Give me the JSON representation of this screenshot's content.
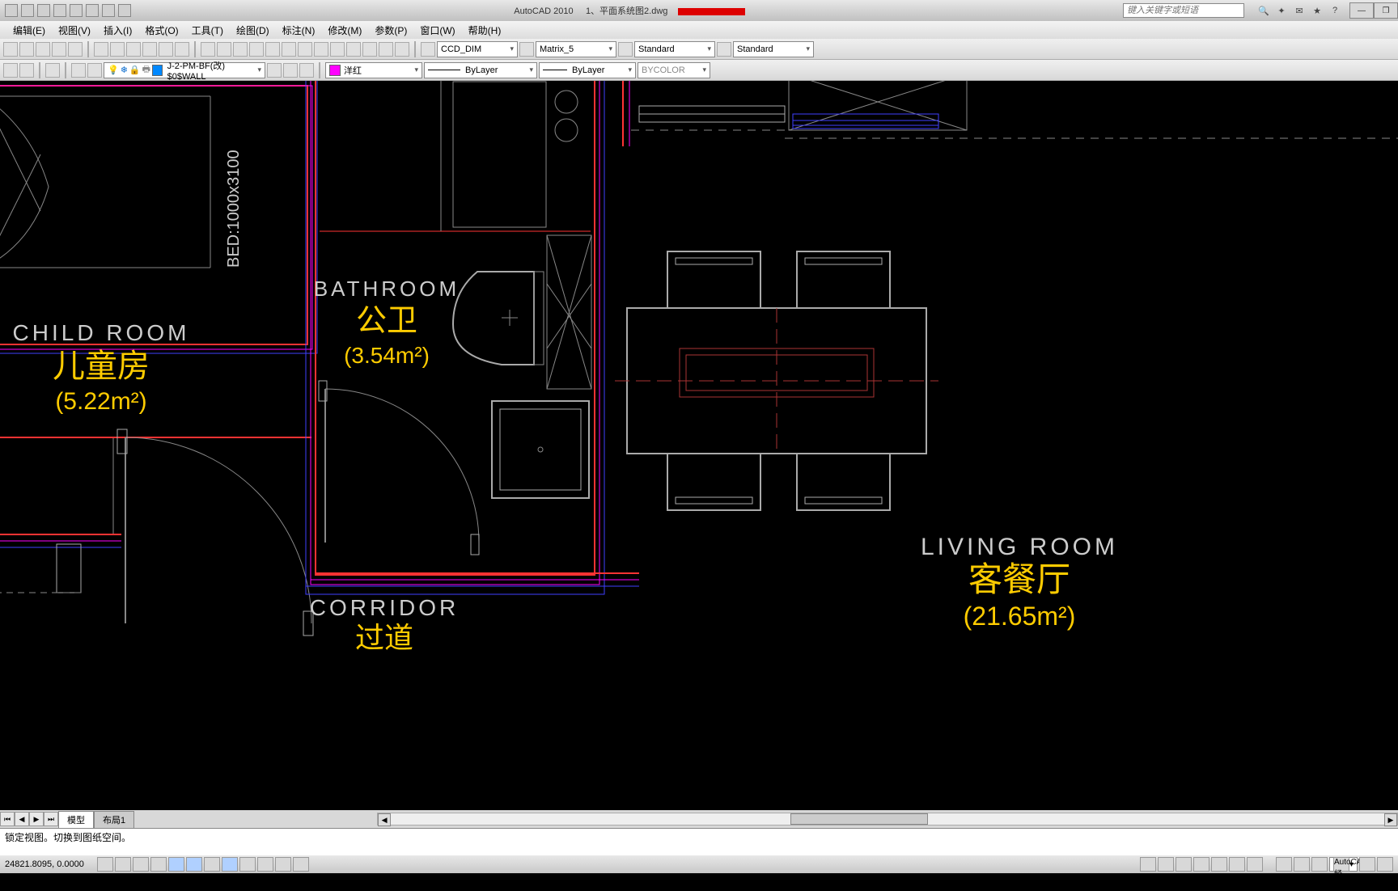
{
  "title": {
    "app": "AutoCAD 2010",
    "file": "1、平面系统图2.dwg",
    "search_placeholder": "键入关键字或短语"
  },
  "menu": {
    "items": [
      "编辑(E)",
      "视图(V)",
      "插入(I)",
      "格式(O)",
      "工具(T)",
      "绘图(D)",
      "标注(N)",
      "修改(M)",
      "参数(P)",
      "窗口(W)",
      "帮助(H)"
    ]
  },
  "toolbar1": {
    "dim_style": "CCD_DIM",
    "text_style": "Matrix_5",
    "table_style": "Standard",
    "mleader_style": "Standard"
  },
  "toolbar2": {
    "layer_name": "J-2-PM-BF(改) $0$WALL",
    "current_color_name": "洋红",
    "current_color_hex": "#ff00ff",
    "lineweight": "ByLayer",
    "linetype": "ByLayer",
    "plot_style": "BYCOLOR"
  },
  "rooms": {
    "child": {
      "en": "CHILD ROOM",
      "cn": "儿童房",
      "area": "(5.22m²)"
    },
    "bath": {
      "en": "BATHROOM",
      "cn": "公卫",
      "area": "(3.54m²)"
    },
    "corridor": {
      "en": "CORRIDOR"
    },
    "living": {
      "en": "LIVING ROOM",
      "cn": "客餐厅",
      "area": "(21.65m²)"
    },
    "bed_label": "BED:1000x3100"
  },
  "tabs": {
    "model": "模型",
    "layout1": "布局1"
  },
  "command": {
    "text": "锁定视图。切换到图纸空间。"
  },
  "status": {
    "coords": "24821.8095, 0.0000",
    "workspace": "AutoCAD 经典"
  }
}
